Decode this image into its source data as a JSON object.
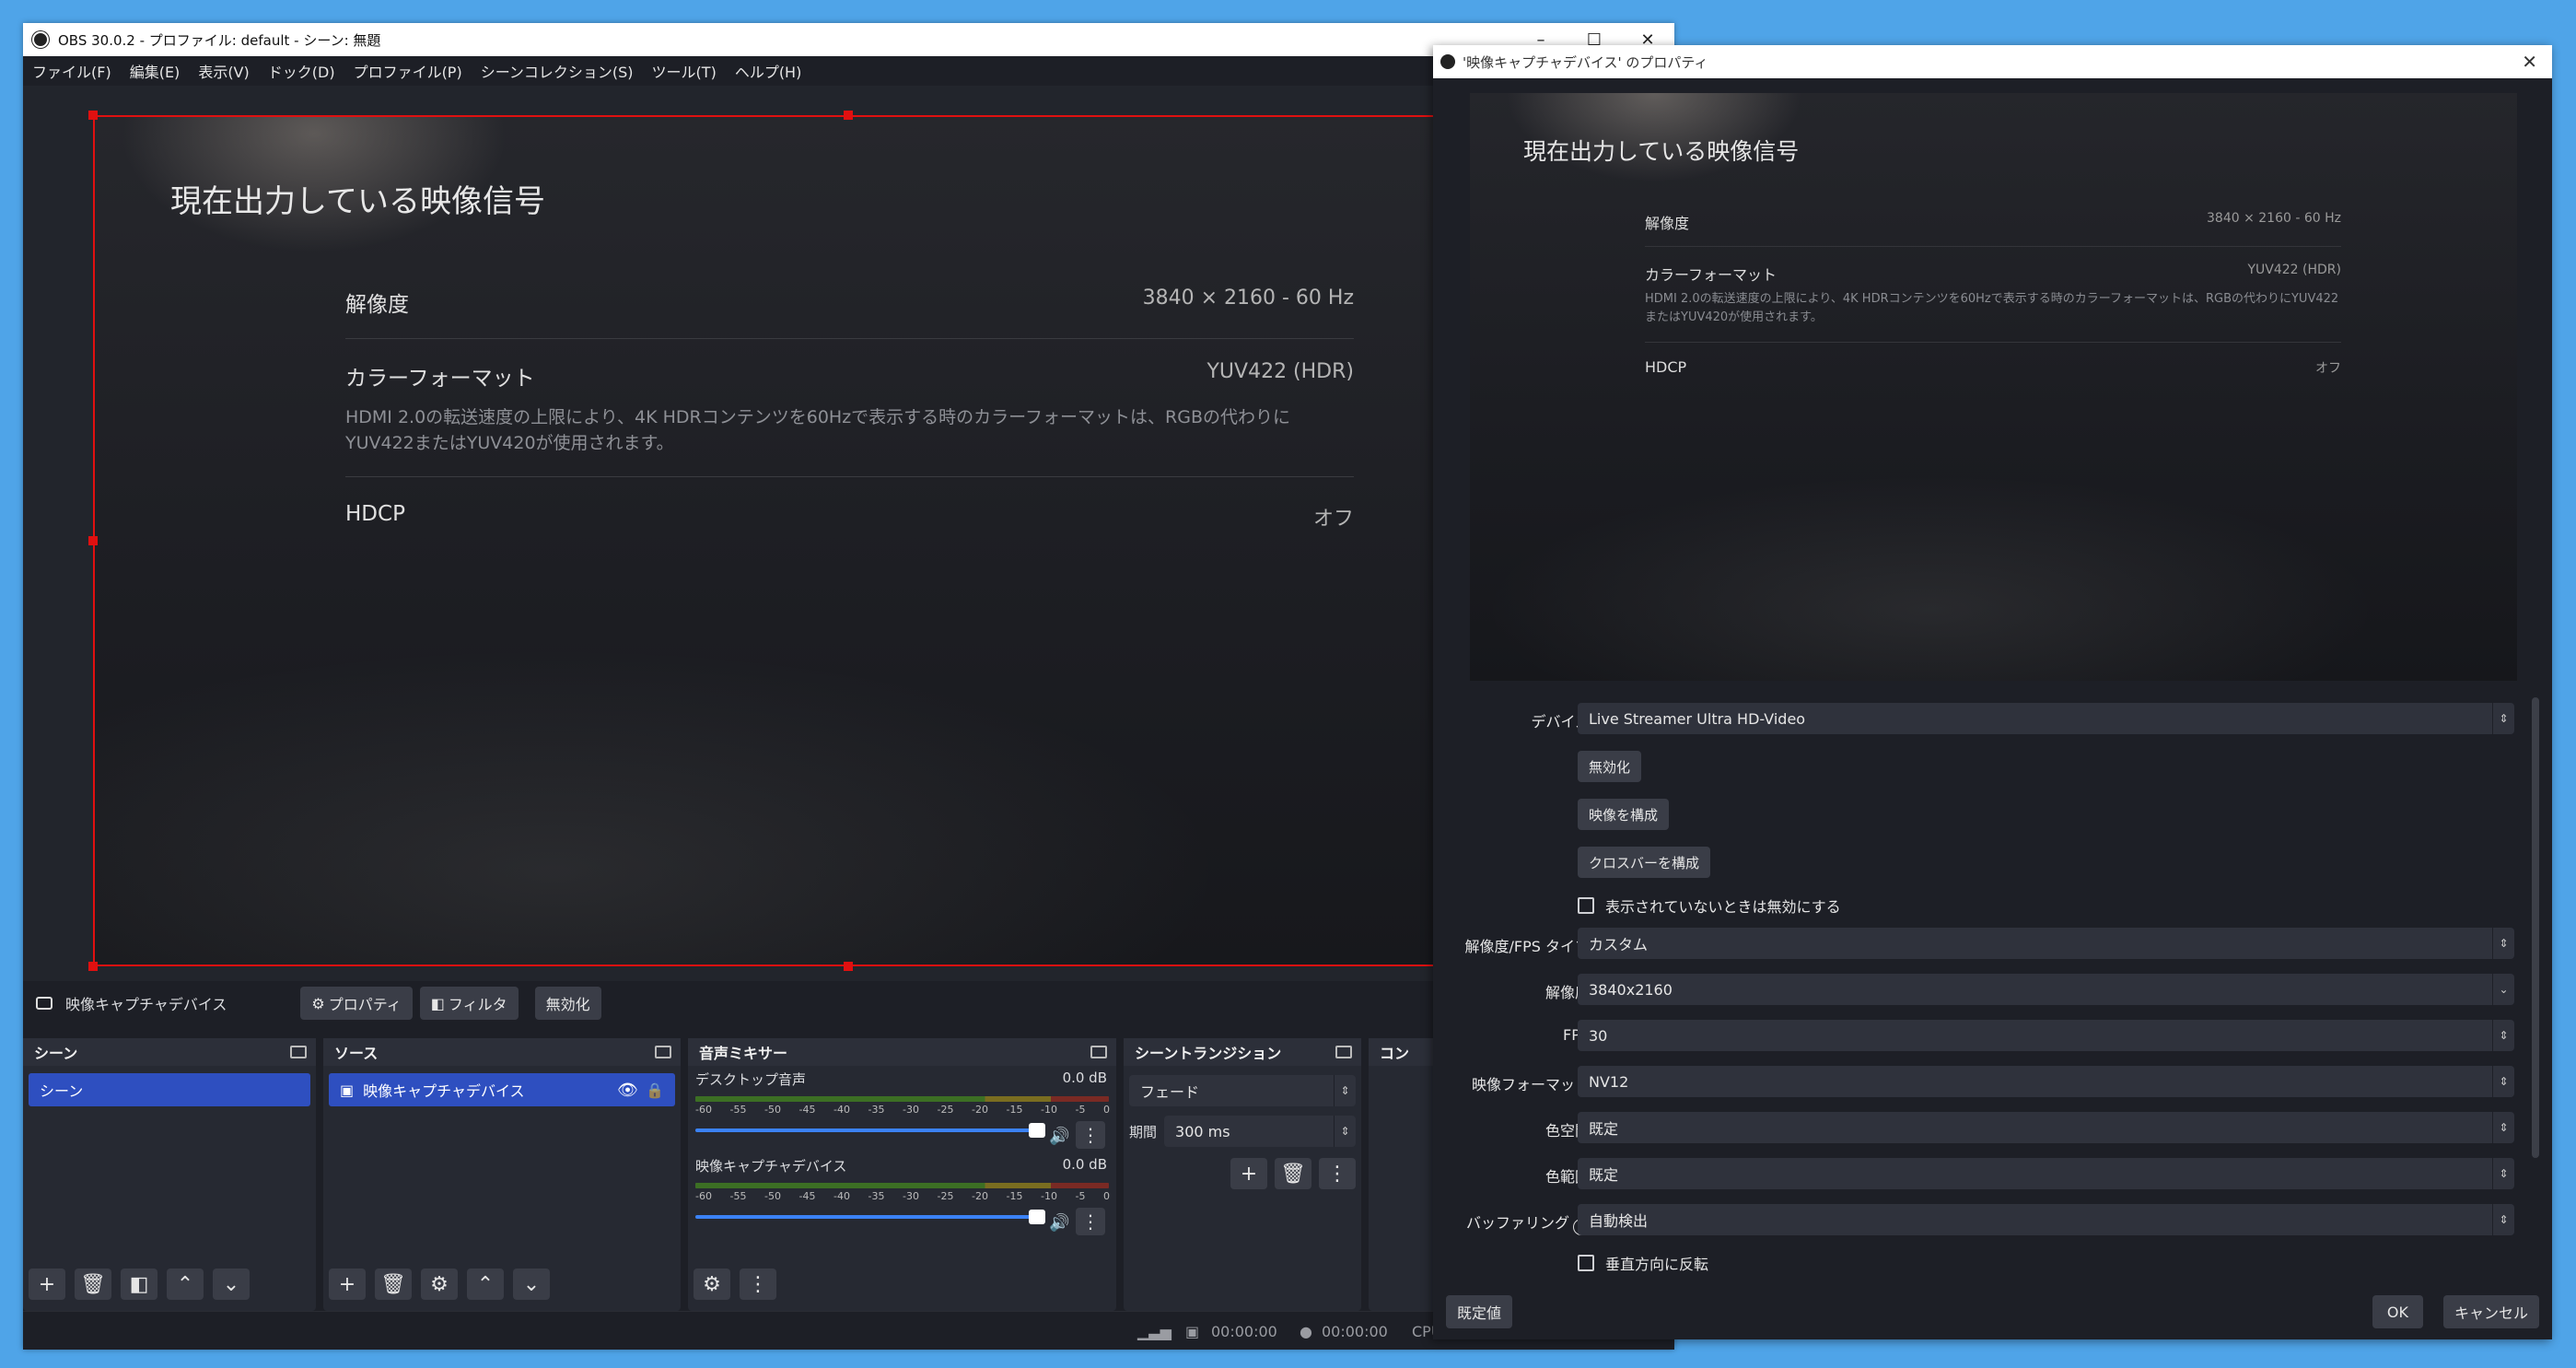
{
  "main_window": {
    "title": "OBS 30.0.2 - プロファイル: default - シーン: 無題",
    "controls": {
      "minimize": "–",
      "maximize": "☐",
      "close": "✕"
    },
    "menu": [
      "ファイル(F)",
      "編集(E)",
      "表示(V)",
      "ドック(D)",
      "プロファイル(P)",
      "シーンコレクション(S)",
      "ツール(T)",
      "ヘルプ(H)"
    ]
  },
  "signal_info": {
    "title": "現在出力している映像信号",
    "resolution_label": "解像度",
    "resolution_value": "3840 × 2160 - 60 Hz",
    "color_format_label": "カラーフォーマット",
    "color_format_value": "YUV422 (HDR)",
    "color_format_note": "HDMI 2.0の転送速度の上限により、4K HDRコンテンツを60Hzで表示する時のカラーフォーマットは、RGBの代わりにYUV422またはYUV420が使用されます。",
    "hdcp_label": "HDCP",
    "hdcp_value": "オフ"
  },
  "source_toolbar": {
    "source_name": "映像キャプチャデバイス",
    "properties": "プロパティ",
    "filters": "フィルタ",
    "disable": "無効化"
  },
  "docks": {
    "scenes": {
      "title": "シーン",
      "items": [
        "シーン"
      ]
    },
    "sources": {
      "title": "ソース",
      "items": [
        "映像キャプチャデバイス"
      ]
    },
    "mixer": {
      "title": "音声ミキサー",
      "channels": [
        {
          "name": "デスクトップ音声",
          "db": "0.0 dB"
        },
        {
          "name": "映像キャプチャデバイス",
          "db": "0.0 dB"
        }
      ],
      "scale": [
        "-60",
        "-55",
        "-50",
        "-45",
        "-40",
        "-35",
        "-30",
        "-25",
        "-20",
        "-15",
        "-10",
        "-5",
        "0"
      ]
    },
    "transitions": {
      "title": "シーントランジション",
      "type": "フェード",
      "duration_label": "期間",
      "duration": "300 ms"
    },
    "controls": {
      "title": "コン"
    }
  },
  "statusbar": {
    "rec_time": "00:00:00",
    "stream_time": "00:00:00",
    "cpu": "CPU"
  },
  "dialog": {
    "title": "'映像キャプチャデバイス' のプロパティ",
    "device_label": "デバイス",
    "device_value": "Live Streamer Ultra HD-Video",
    "btn_disable": "無効化",
    "btn_config_video": "映像を構成",
    "btn_config_crossbar": "クロスバーを構成",
    "chk_disable_hidden": "表示されていないときは無効にする",
    "res_fps_type_label": "解像度/FPS タイプ",
    "res_fps_type_value": "カスタム",
    "resolution_label": "解像度",
    "resolution_value": "3840x2160",
    "fps_label": "FPS",
    "fps_value": "30",
    "video_format_label": "映像フォーマット",
    "video_format_value": "NV12",
    "color_space_label": "色空間",
    "color_space_value": "既定",
    "color_range_label": "色範囲",
    "color_range_value": "既定",
    "buffering_label": "バッファリング",
    "buffering_value": "自動検出",
    "chk_flip_vertical": "垂直方向に反転",
    "defaults": "既定値",
    "ok": "OK",
    "cancel": "キャンセル"
  }
}
